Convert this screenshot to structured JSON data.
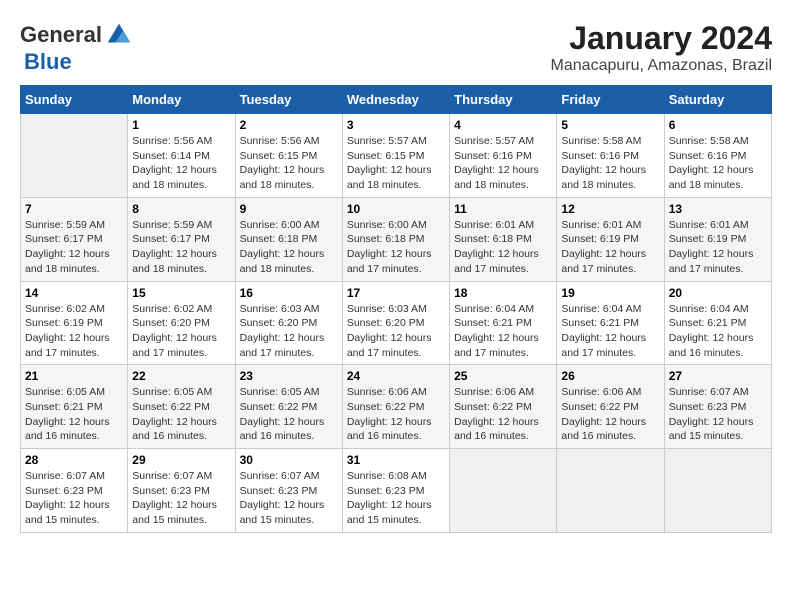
{
  "header": {
    "logo_general": "General",
    "logo_blue": "Blue",
    "title": "January 2024",
    "subtitle": "Manacapuru, Amazonas, Brazil"
  },
  "columns": [
    "Sunday",
    "Monday",
    "Tuesday",
    "Wednesday",
    "Thursday",
    "Friday",
    "Saturday"
  ],
  "weeks": [
    [
      {
        "day": "",
        "sunrise": "",
        "sunset": "",
        "daylight": ""
      },
      {
        "day": "1",
        "sunrise": "Sunrise: 5:56 AM",
        "sunset": "Sunset: 6:14 PM",
        "daylight": "Daylight: 12 hours and 18 minutes."
      },
      {
        "day": "2",
        "sunrise": "Sunrise: 5:56 AM",
        "sunset": "Sunset: 6:15 PM",
        "daylight": "Daylight: 12 hours and 18 minutes."
      },
      {
        "day": "3",
        "sunrise": "Sunrise: 5:57 AM",
        "sunset": "Sunset: 6:15 PM",
        "daylight": "Daylight: 12 hours and 18 minutes."
      },
      {
        "day": "4",
        "sunrise": "Sunrise: 5:57 AM",
        "sunset": "Sunset: 6:16 PM",
        "daylight": "Daylight: 12 hours and 18 minutes."
      },
      {
        "day": "5",
        "sunrise": "Sunrise: 5:58 AM",
        "sunset": "Sunset: 6:16 PM",
        "daylight": "Daylight: 12 hours and 18 minutes."
      },
      {
        "day": "6",
        "sunrise": "Sunrise: 5:58 AM",
        "sunset": "Sunset: 6:16 PM",
        "daylight": "Daylight: 12 hours and 18 minutes."
      }
    ],
    [
      {
        "day": "7",
        "sunrise": "Sunrise: 5:59 AM",
        "sunset": "Sunset: 6:17 PM",
        "daylight": "Daylight: 12 hours and 18 minutes."
      },
      {
        "day": "8",
        "sunrise": "Sunrise: 5:59 AM",
        "sunset": "Sunset: 6:17 PM",
        "daylight": "Daylight: 12 hours and 18 minutes."
      },
      {
        "day": "9",
        "sunrise": "Sunrise: 6:00 AM",
        "sunset": "Sunset: 6:18 PM",
        "daylight": "Daylight: 12 hours and 18 minutes."
      },
      {
        "day": "10",
        "sunrise": "Sunrise: 6:00 AM",
        "sunset": "Sunset: 6:18 PM",
        "daylight": "Daylight: 12 hours and 17 minutes."
      },
      {
        "day": "11",
        "sunrise": "Sunrise: 6:01 AM",
        "sunset": "Sunset: 6:18 PM",
        "daylight": "Daylight: 12 hours and 17 minutes."
      },
      {
        "day": "12",
        "sunrise": "Sunrise: 6:01 AM",
        "sunset": "Sunset: 6:19 PM",
        "daylight": "Daylight: 12 hours and 17 minutes."
      },
      {
        "day": "13",
        "sunrise": "Sunrise: 6:01 AM",
        "sunset": "Sunset: 6:19 PM",
        "daylight": "Daylight: 12 hours and 17 minutes."
      }
    ],
    [
      {
        "day": "14",
        "sunrise": "Sunrise: 6:02 AM",
        "sunset": "Sunset: 6:19 PM",
        "daylight": "Daylight: 12 hours and 17 minutes."
      },
      {
        "day": "15",
        "sunrise": "Sunrise: 6:02 AM",
        "sunset": "Sunset: 6:20 PM",
        "daylight": "Daylight: 12 hours and 17 minutes."
      },
      {
        "day": "16",
        "sunrise": "Sunrise: 6:03 AM",
        "sunset": "Sunset: 6:20 PM",
        "daylight": "Daylight: 12 hours and 17 minutes."
      },
      {
        "day": "17",
        "sunrise": "Sunrise: 6:03 AM",
        "sunset": "Sunset: 6:20 PM",
        "daylight": "Daylight: 12 hours and 17 minutes."
      },
      {
        "day": "18",
        "sunrise": "Sunrise: 6:04 AM",
        "sunset": "Sunset: 6:21 PM",
        "daylight": "Daylight: 12 hours and 17 minutes."
      },
      {
        "day": "19",
        "sunrise": "Sunrise: 6:04 AM",
        "sunset": "Sunset: 6:21 PM",
        "daylight": "Daylight: 12 hours and 17 minutes."
      },
      {
        "day": "20",
        "sunrise": "Sunrise: 6:04 AM",
        "sunset": "Sunset: 6:21 PM",
        "daylight": "Daylight: 12 hours and 16 minutes."
      }
    ],
    [
      {
        "day": "21",
        "sunrise": "Sunrise: 6:05 AM",
        "sunset": "Sunset: 6:21 PM",
        "daylight": "Daylight: 12 hours and 16 minutes."
      },
      {
        "day": "22",
        "sunrise": "Sunrise: 6:05 AM",
        "sunset": "Sunset: 6:22 PM",
        "daylight": "Daylight: 12 hours and 16 minutes."
      },
      {
        "day": "23",
        "sunrise": "Sunrise: 6:05 AM",
        "sunset": "Sunset: 6:22 PM",
        "daylight": "Daylight: 12 hours and 16 minutes."
      },
      {
        "day": "24",
        "sunrise": "Sunrise: 6:06 AM",
        "sunset": "Sunset: 6:22 PM",
        "daylight": "Daylight: 12 hours and 16 minutes."
      },
      {
        "day": "25",
        "sunrise": "Sunrise: 6:06 AM",
        "sunset": "Sunset: 6:22 PM",
        "daylight": "Daylight: 12 hours and 16 minutes."
      },
      {
        "day": "26",
        "sunrise": "Sunrise: 6:06 AM",
        "sunset": "Sunset: 6:22 PM",
        "daylight": "Daylight: 12 hours and 16 minutes."
      },
      {
        "day": "27",
        "sunrise": "Sunrise: 6:07 AM",
        "sunset": "Sunset: 6:23 PM",
        "daylight": "Daylight: 12 hours and 15 minutes."
      }
    ],
    [
      {
        "day": "28",
        "sunrise": "Sunrise: 6:07 AM",
        "sunset": "Sunset: 6:23 PM",
        "daylight": "Daylight: 12 hours and 15 minutes."
      },
      {
        "day": "29",
        "sunrise": "Sunrise: 6:07 AM",
        "sunset": "Sunset: 6:23 PM",
        "daylight": "Daylight: 12 hours and 15 minutes."
      },
      {
        "day": "30",
        "sunrise": "Sunrise: 6:07 AM",
        "sunset": "Sunset: 6:23 PM",
        "daylight": "Daylight: 12 hours and 15 minutes."
      },
      {
        "day": "31",
        "sunrise": "Sunrise: 6:08 AM",
        "sunset": "Sunset: 6:23 PM",
        "daylight": "Daylight: 12 hours and 15 minutes."
      },
      {
        "day": "",
        "sunrise": "",
        "sunset": "",
        "daylight": ""
      },
      {
        "day": "",
        "sunrise": "",
        "sunset": "",
        "daylight": ""
      },
      {
        "day": "",
        "sunrise": "",
        "sunset": "",
        "daylight": ""
      }
    ]
  ]
}
